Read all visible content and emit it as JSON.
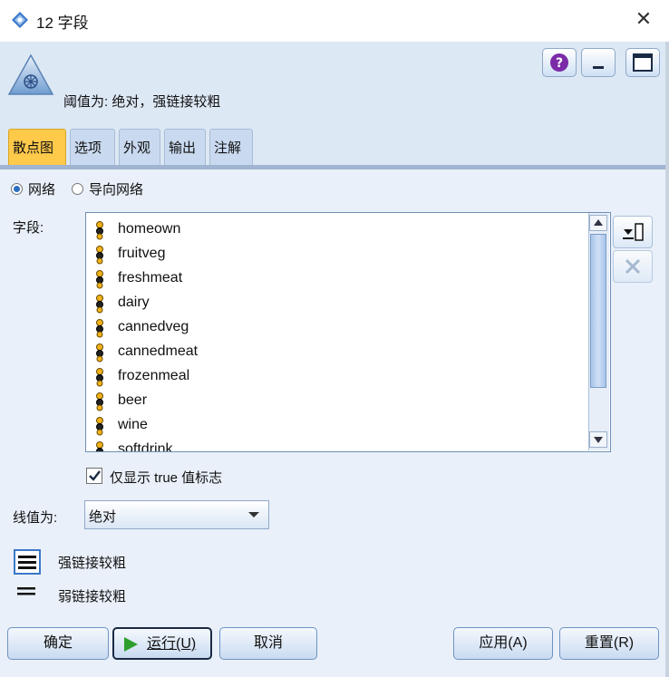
{
  "window": {
    "title": "12 字段",
    "close_glyph": "✕"
  },
  "header": {
    "threshold_text": "阈值为: 绝对，强链接较粗",
    "icons": [
      "help-icon",
      "minimize-icon",
      "maximize-icon"
    ]
  },
  "tabs": [
    {
      "label": "散点图",
      "active": true
    },
    {
      "label": "选项",
      "active": false
    },
    {
      "label": "外观",
      "active": false
    },
    {
      "label": "输出",
      "active": false
    },
    {
      "label": "注解",
      "active": false
    }
  ],
  "network_type": {
    "options": [
      "网络",
      "导向网络"
    ],
    "selected": "网络"
  },
  "fields": {
    "label": "字段:",
    "items": [
      "homeown",
      "fruitveg",
      "freshmeat",
      "dairy",
      "cannedveg",
      "cannedmeat",
      "frozenmeal",
      "beer",
      "wine",
      "softdrink"
    ]
  },
  "show_true_only": {
    "label": "仅显示 true 值标志",
    "checked": true
  },
  "line_value": {
    "label": "线值为:",
    "selected": "绝对"
  },
  "legend": {
    "strong": "强链接较粗",
    "weak": "弱链接较粗"
  },
  "buttons": {
    "ok": "确定",
    "run": "运行(U)",
    "cancel": "取消",
    "apply": "应用(A)",
    "reset": "重置(R)"
  },
  "colors": {
    "active_tab": "#ffc94a",
    "panel_bg": "#e9f0f9",
    "header_bg": "#dde8f5",
    "run_icon": "#2e9e2e",
    "field_icon": "#e6a817"
  }
}
